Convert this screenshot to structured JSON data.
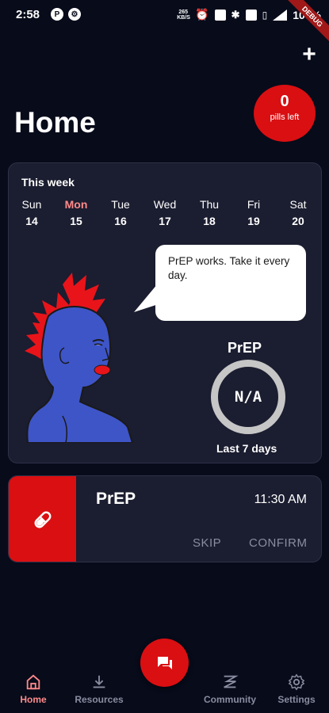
{
  "status_bar": {
    "time": "2:58",
    "left_icons": [
      "p-icon",
      "settings-circle-icon"
    ],
    "speed_top": "265",
    "speed_bottom": "KB/S",
    "battery": "100%",
    "debug_label": "DEBUG"
  },
  "header": {
    "title": "Home",
    "pills_left_count": "0",
    "pills_left_label": "pills left"
  },
  "week": {
    "title": "This week",
    "days": [
      {
        "name": "Sun",
        "num": "14"
      },
      {
        "name": "Mon",
        "num": "15"
      },
      {
        "name": "Tue",
        "num": "16"
      },
      {
        "name": "Wed",
        "num": "17"
      },
      {
        "name": "Thu",
        "num": "18"
      },
      {
        "name": "Fri",
        "num": "19"
      },
      {
        "name": "Sat",
        "num": "20"
      }
    ],
    "current_day": "Mon",
    "speech": "PrEP works. Take it every day.",
    "adherence_title": "PrEP",
    "adherence_value": "N/A",
    "adherence_caption": "Last 7 days"
  },
  "dose": {
    "name": "PrEP",
    "time": "11:30 AM",
    "skip_label": "SKIP",
    "confirm_label": "CONFIRM"
  },
  "nav": {
    "items": [
      {
        "label": "Home",
        "icon": "home-icon"
      },
      {
        "label": "Resources",
        "icon": "download-icon"
      },
      {
        "label": "Community",
        "icon": "community-icon"
      },
      {
        "label": "Settings",
        "icon": "gear-icon"
      }
    ],
    "fab_icon": "chat-icon"
  },
  "colors": {
    "background": "#070b1a",
    "card": "#1b1d30",
    "accent": "#d90f12",
    "active": "#ff8a8a",
    "muted": "#8a8ca0"
  }
}
